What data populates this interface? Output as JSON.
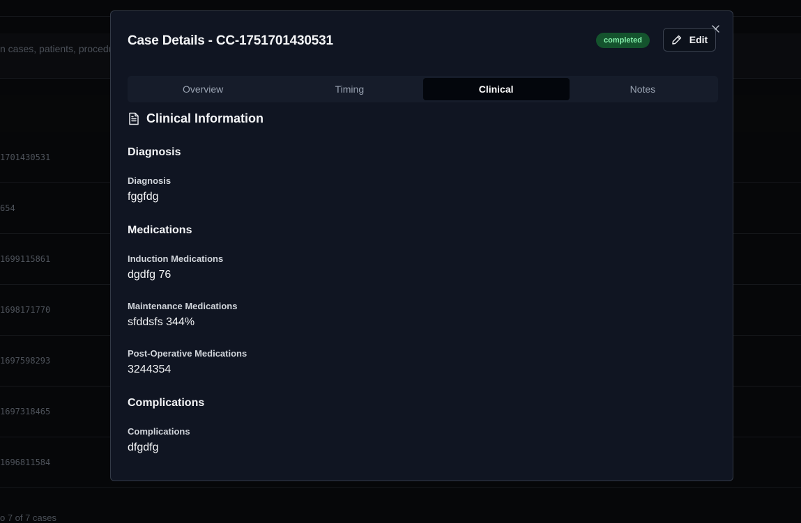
{
  "background": {
    "search_placeholder": "n cases, patients, procedu",
    "case_ids": [
      "1701430531",
      "654",
      "1699115861",
      "1698171770",
      "1697598293",
      "1697318465",
      "1696811584"
    ],
    "footer": "o 7 of 7 cases"
  },
  "modal": {
    "title": "Case Details - CC-1751701430531",
    "status": "completed",
    "edit_label": "Edit",
    "tabs": [
      {
        "label": "Overview"
      },
      {
        "label": "Timing"
      },
      {
        "label": "Clinical"
      },
      {
        "label": "Notes"
      }
    ],
    "active_tab": "Clinical",
    "section_title": "Clinical Information",
    "groups": {
      "diagnosis": {
        "title": "Diagnosis",
        "fields": [
          {
            "label": "Diagnosis",
            "value": "fggfdg"
          }
        ]
      },
      "medications": {
        "title": "Medications",
        "fields": [
          {
            "label": "Induction Medications",
            "value": "dgdfg 76"
          },
          {
            "label": "Maintenance Medications",
            "value": "sfddsfs 344%"
          },
          {
            "label": "Post-Operative Medications",
            "value": "3244354"
          }
        ]
      },
      "complications": {
        "title": "Complications",
        "fields": [
          {
            "label": "Complications",
            "value": "dfgdfg"
          }
        ]
      }
    }
  },
  "colors": {
    "badge_bg": "#14532d",
    "badge_text": "#86efac",
    "modal_bg": "#101522",
    "active_tab_bg": "#03060c"
  },
  "icons": {
    "close": "close-icon",
    "edit": "pencil-icon",
    "section": "document-icon"
  }
}
